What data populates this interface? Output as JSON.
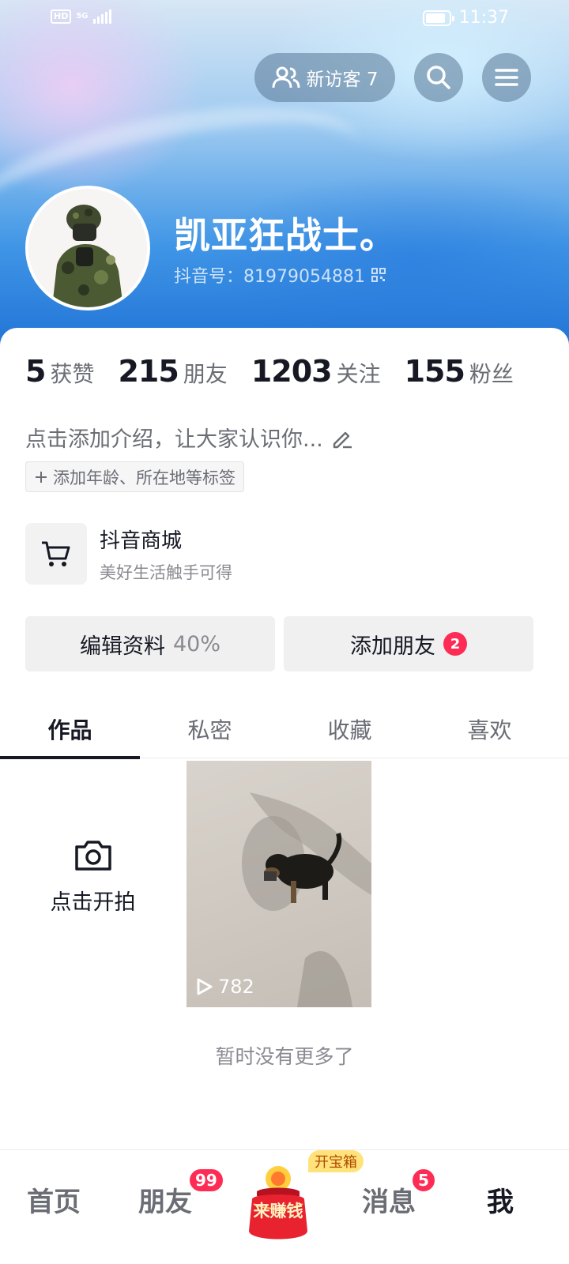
{
  "status_bar": {
    "hd": "HD",
    "network": "5G",
    "time": "11:37"
  },
  "header": {
    "visitors_label": "新访客 7",
    "username": "凯亚狂战士。",
    "douyin_id": "抖音号：81979054881"
  },
  "stats": [
    {
      "value": "5",
      "label": "获赞"
    },
    {
      "value": "215",
      "label": "朋友"
    },
    {
      "value": "1203",
      "label": "关注"
    },
    {
      "value": "155",
      "label": "粉丝"
    }
  ],
  "profile": {
    "bio_placeholder": "点击添加介绍，让大家认识你...",
    "tag_chip": "添加年龄、所在地等标签"
  },
  "shop": {
    "title": "抖音商城",
    "subtitle": "美好生活触手可得"
  },
  "actions": {
    "edit_label": "编辑资料",
    "edit_progress": "40%",
    "add_friend_label": "添加朋友",
    "add_friend_badge": "2"
  },
  "tabs": [
    "作品",
    "私密",
    "收藏",
    "喜欢"
  ],
  "content": {
    "shoot_label": "点击开拍",
    "video_play_count": "782",
    "no_more": "暂时没有更多了"
  },
  "bottom_nav": {
    "home": "首页",
    "friends": "朋友",
    "friends_badge": "99",
    "earn": "来赚钱",
    "treasure": "开宝箱",
    "messages": "消息",
    "messages_badge": "5",
    "me": "我"
  },
  "colors": {
    "accent_red": "#fe2c55",
    "text_primary": "#161823",
    "text_secondary": "#6b6d75"
  },
  "icons": [
    "signal-icon",
    "battery-icon",
    "visitors-icon",
    "search-icon",
    "menu-icon",
    "qr-code-icon",
    "edit-pencil-icon",
    "plus-icon",
    "cart-icon",
    "camera-icon",
    "play-icon"
  ]
}
